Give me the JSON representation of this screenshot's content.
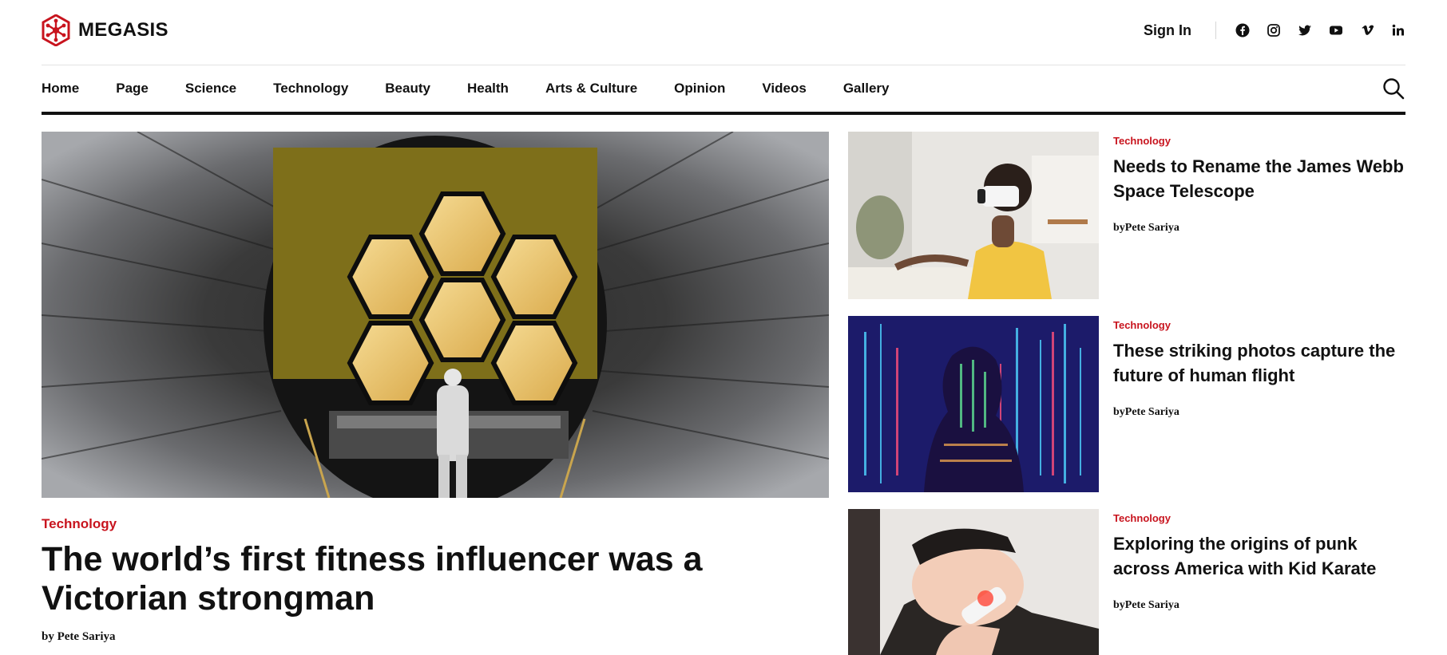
{
  "brand": {
    "name": "MEGASIS",
    "accent": "#c8141e"
  },
  "header": {
    "sign_in": "Sign In",
    "social_icons": [
      "facebook-icon",
      "instagram-icon",
      "twitter-icon",
      "youtube-icon",
      "vimeo-icon",
      "linkedin-icon"
    ]
  },
  "nav": {
    "items": [
      "Home",
      "Page",
      "Science",
      "Technology",
      "Beauty",
      "Health",
      "Arts & Culture",
      "Opinion",
      "Videos",
      "Gallery"
    ],
    "search_icon": "search-icon"
  },
  "hero": {
    "category": "Technology",
    "title": "The world’s first fitness influencer was a Victorian strongman",
    "byline": "by Pete Sariya"
  },
  "side_articles": [
    {
      "category": "Technology",
      "title": "Needs to Rename the James Webb Space Telescope",
      "byline": "byPete Sariya"
    },
    {
      "category": "Technology",
      "title": "These striking photos capture the future of human flight",
      "byline": "byPete Sariya"
    },
    {
      "category": "Technology",
      "title": "Exploring the origins of punk across America with Kid Karate",
      "byline": "byPete Sariya"
    }
  ]
}
